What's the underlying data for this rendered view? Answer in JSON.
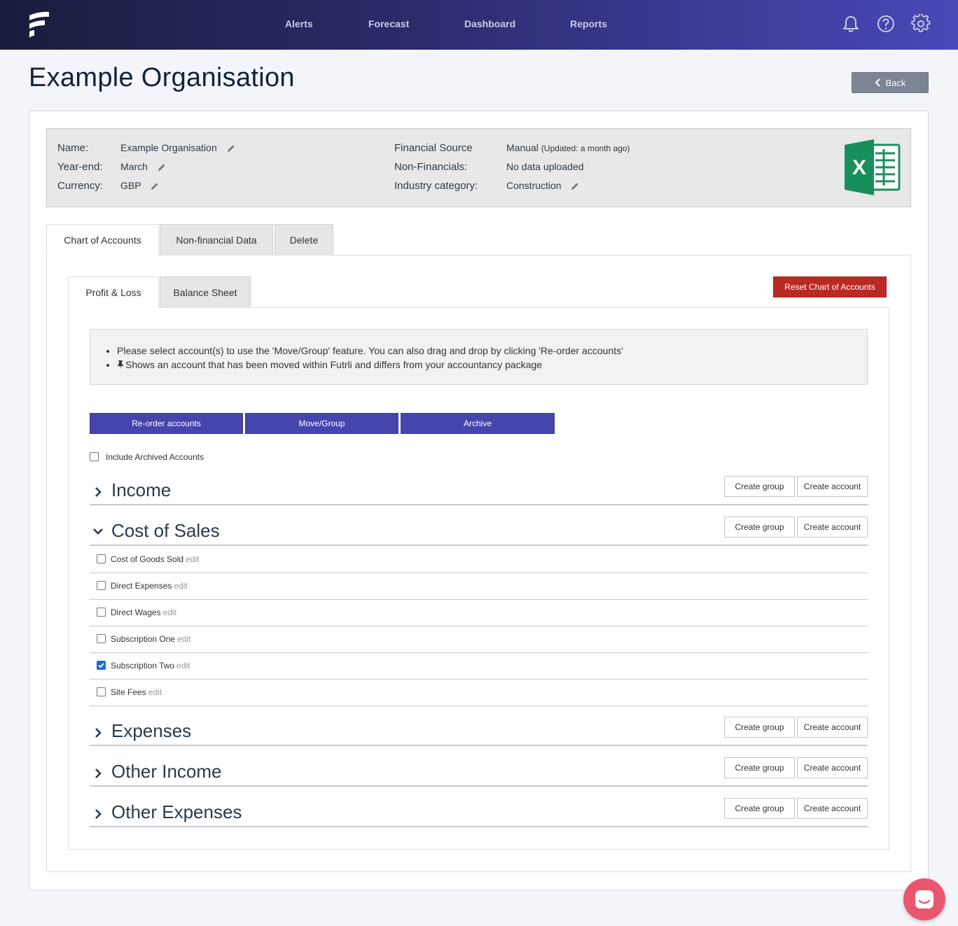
{
  "nav": {
    "links": [
      "Alerts",
      "Forecast",
      "Dashboard",
      "Reports"
    ],
    "icons": [
      "bell-icon",
      "help-icon",
      "gear-icon"
    ]
  },
  "page": {
    "title": "Example Organisation",
    "back_label": "Back"
  },
  "org_info": {
    "name_label": "Name:",
    "name_value": "Example Organisation",
    "yearend_label": "Year-end:",
    "yearend_value": "March",
    "currency_label": "Currency:",
    "currency_value": "GBP",
    "fin_source_label": "Financial Source",
    "fin_source_value": "Manual",
    "fin_source_updated": "(Updated: a month ago)",
    "nonfin_label": "Non-Financials:",
    "nonfin_value": "No data uploaded",
    "industry_label": "Industry category:",
    "industry_value": "Construction"
  },
  "tabs": [
    "Chart of Accounts",
    "Non-financial Data",
    "Delete"
  ],
  "subtabs": [
    "Profit & Loss",
    "Balance Sheet"
  ],
  "reset_label": "Reset Chart of Accounts",
  "notice": {
    "line1": "Please select account(s) to use the 'Move/Group' feature. You can also drag and drop by clicking 'Re-order accounts'",
    "line2": "Shows an account that has been moved within Futrli and differs from your accountancy package"
  },
  "actions": [
    "Re-order accounts",
    "Move/Group",
    "Archive"
  ],
  "include_archived_label": "Include Archived Accounts",
  "create_group_label": "Create group",
  "create_account_label": "Create account",
  "edit_label": "edit",
  "sections": [
    {
      "title": "Income",
      "expanded": false
    },
    {
      "title": "Cost of Sales",
      "expanded": true
    },
    {
      "title": "Expenses",
      "expanded": false
    },
    {
      "title": "Other Income",
      "expanded": false
    },
    {
      "title": "Other Expenses",
      "expanded": false
    }
  ],
  "cost_of_sales_accounts": [
    {
      "name": "Cost of Goods Sold",
      "checked": false
    },
    {
      "name": "Direct Expenses",
      "checked": false
    },
    {
      "name": "Direct Wages",
      "checked": false
    },
    {
      "name": "Subscription One",
      "checked": false
    },
    {
      "name": "Subscription Two",
      "checked": true
    },
    {
      "name": "Site Fees",
      "checked": false
    }
  ],
  "colors": {
    "primary": "#4545ad",
    "danger": "#b92a25",
    "nav_start": "#1a1c3c",
    "nav_end": "#4a48b8",
    "chat": "#e8576e"
  }
}
